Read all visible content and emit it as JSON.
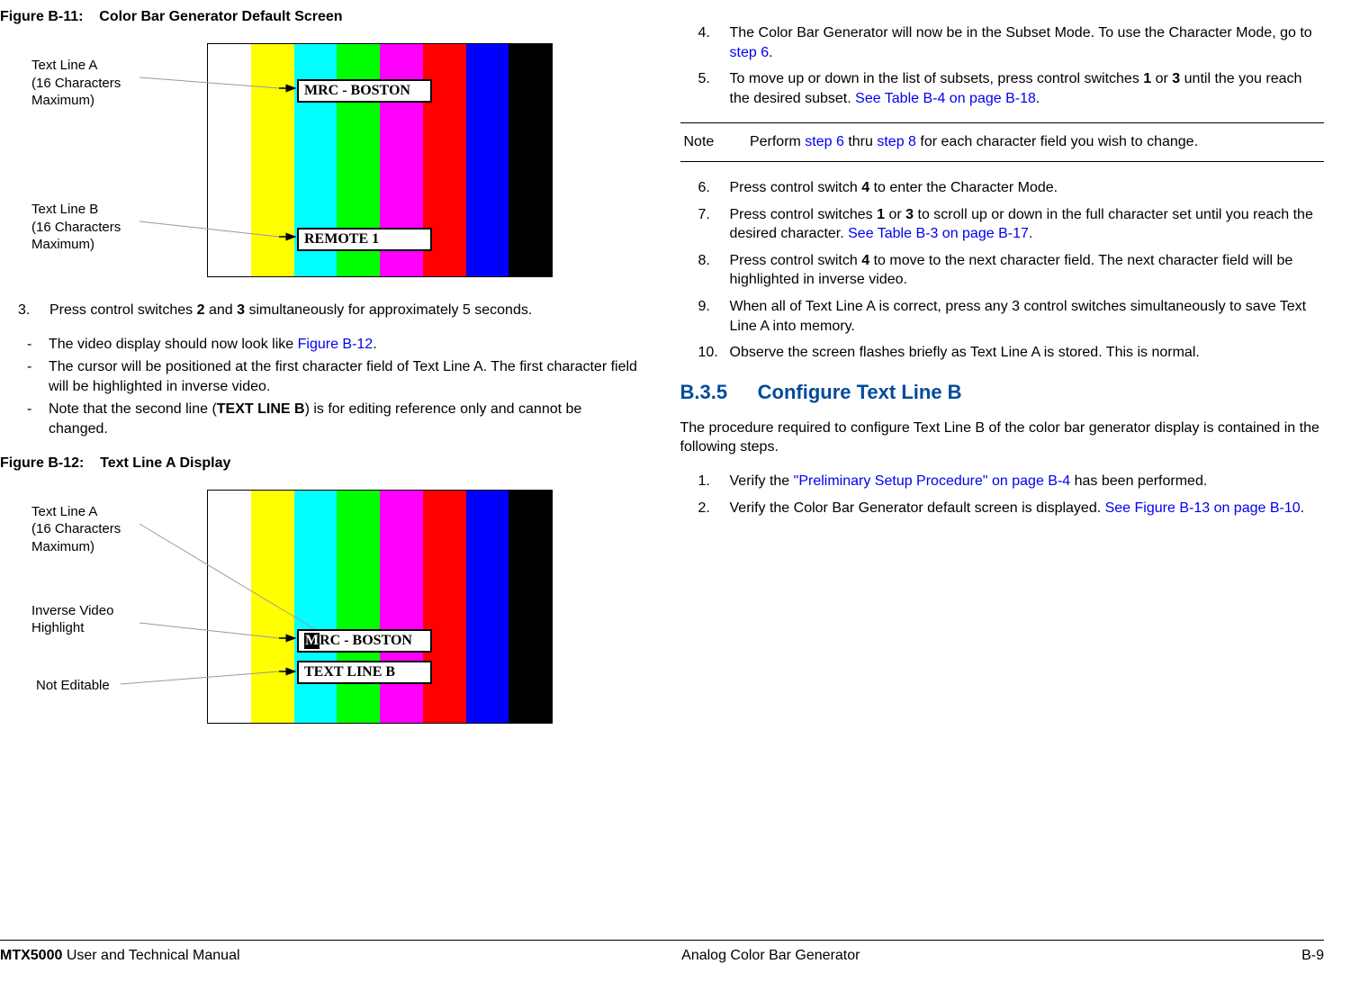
{
  "figure11": {
    "label": "Figure B-11:",
    "title": "Color Bar Generator Default Screen",
    "calloutA_l1": "Text Line A",
    "calloutA_l2": "(16 Characters",
    "calloutA_l3": "Maximum)",
    "calloutB_l1": "Text Line B",
    "calloutB_l2": "(16 Characters",
    "calloutB_l3": "Maximum)",
    "boxA": "MRC - BOSTON",
    "boxB": "REMOTE 1"
  },
  "step3": {
    "num": "3.",
    "text_a": "Press control switches ",
    "sw2": "2",
    "text_b": " and ",
    "sw3": "3",
    "text_c": " simultaneously for approximately 5 seconds.",
    "sub1_a": "The video display should now look like ",
    "sub1_link": "Figure B-12",
    "sub1_b": ".",
    "sub2": "The cursor will be positioned at the first character field of Text Line A.  The first character field will be highlighted in inverse video.",
    "sub3_a": "Note that the second line (",
    "sub3_bold": "TEXT LINE B",
    "sub3_b": ") is for editing reference only and cannot be changed."
  },
  "figure12": {
    "label": "Figure B-12:",
    "title": "Text Line A Display",
    "calloutA_l1": "Text Line A",
    "calloutA_l2": "(16 Characters",
    "calloutA_l3": "Maximum)",
    "calloutInv_l1": "Inverse Video",
    "calloutInv_l2": "Highlight",
    "calloutNE": "Not Editable",
    "boxA_first": "M",
    "boxA_rest": "RC - BOSTON",
    "boxB": "TEXT LINE B"
  },
  "step4": {
    "num": "4.",
    "text_a": "The Color Bar Generator will now be in the Subset Mode.  To use the Character Mode, go to ",
    "link": "step 6",
    "text_b": "."
  },
  "step5": {
    "num": "5.",
    "text_a": "To move up or down in the list of subsets, press control switches ",
    "sw1": "1",
    "text_b": " or ",
    "sw3": "3",
    "text_c": " until the you reach the desired subset. ",
    "link": "See Table B-4 on page B-18",
    "text_d": "."
  },
  "note": {
    "label": "Note",
    "text_a": "Perform ",
    "link1": "step 6",
    "text_b": " thru ",
    "link2": "step 8",
    "text_c": " for each character field you wish to change."
  },
  "step6": {
    "num": "6.",
    "text_a": "Press control switch ",
    "sw4": "4",
    "text_b": " to enter the Character Mode."
  },
  "step7": {
    "num": "7.",
    "text_a": "Press control switches ",
    "sw1": "1",
    "text_b": " or ",
    "sw3": "3",
    "text_c": " to scroll up or down in the full character set until you reach the desired character. ",
    "link": "See Table B-3 on page B-17",
    "text_d": "."
  },
  "step8": {
    "num": "8.",
    "text_a": "Press control switch ",
    "sw4": "4",
    "text_b": " to move to the next character field.  The next character field will be highlighted in inverse video."
  },
  "step9": {
    "num": "9.",
    "text": "When all of Text Line A is correct, press any 3 control switches simultaneously to save Text Line A into memory."
  },
  "step10": {
    "num": "10.",
    "text": "Observe the screen flashes briefly as Text Line A is stored.  This is normal."
  },
  "sectionB35": {
    "num": "B.3.5",
    "title": "Configure Text Line B",
    "intro": "The procedure required to configure Text Line B of the color bar generator display is contained in the following steps."
  },
  "b35_step1": {
    "num": "1.",
    "text_a": "Verify the ",
    "link": "\"Preliminary Setup Procedure\" on page B-4",
    "text_b": " has been performed."
  },
  "b35_step2": {
    "num": "2.",
    "text_a": "Verify the Color Bar Generator default screen is displayed.  ",
    "link": "See Figure B-13 on page B-10",
    "text_b": "."
  },
  "footer": {
    "left_bold": "MTX5000",
    "left_rest": " User and Technical Manual",
    "center": "Analog Color Bar Generator",
    "right": "B-9"
  }
}
